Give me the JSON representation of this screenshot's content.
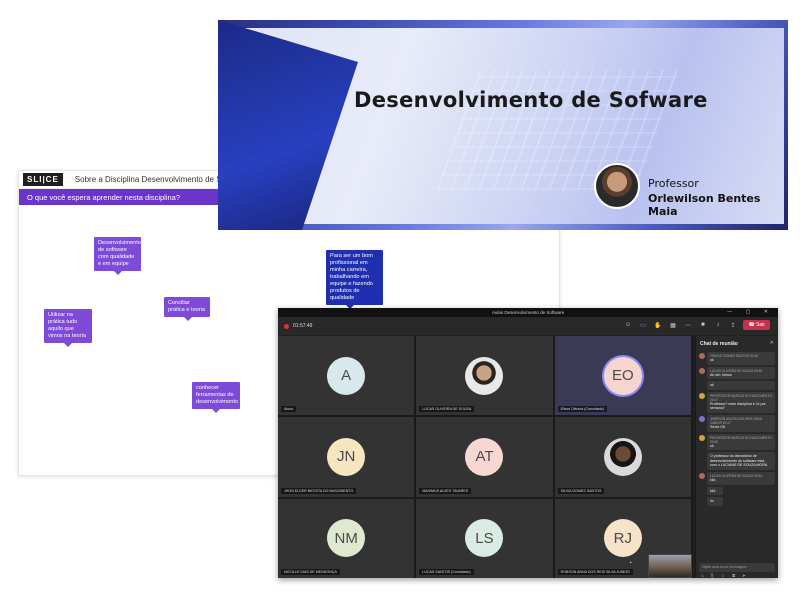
{
  "slido": {
    "logo": "SLI|CE",
    "title": "Sobre a Disciplina Desenvolvimento de Software",
    "question": "O que você espera aprender nesta disciplina?",
    "notes": [
      {
        "text": "Desenvolvimento de software com qualidade e em equipe",
        "color": "purple"
      },
      {
        "text": "Utilizar na prática tudo aquilo que vimos na teoria",
        "color": "purple"
      },
      {
        "text": "Conciliar prática e teoria",
        "color": "purple"
      },
      {
        "text": "conhecer ferramentas de desenvolvimento",
        "color": "purple"
      },
      {
        "text": "Para ser um bom profissional em minha carreira, trabalhando em equipe e fazendo produtos de qualidade",
        "color": "blue"
      }
    ]
  },
  "banner": {
    "title": "Desenvolvimento de Sofware",
    "professor_label": "Professor",
    "professor_name": "Orlewilson Bentes Maia"
  },
  "teams": {
    "window_title": "Aulas Desenvolvimento de Software",
    "window_controls": "— ▢ ✕",
    "timer": "01:57:49",
    "leave_label": "Sair",
    "participants": [
      {
        "initials": "A",
        "name": "Aluno",
        "avatar_color": "#d9e8ec",
        "photo": false,
        "speaking": false
      },
      {
        "initials": "",
        "name": "LUCAS OLIVEIRA DE SOUSA",
        "avatar_color": "",
        "photo": true,
        "speaking": false
      },
      {
        "initials": "EO",
        "name": "Eltron Oliveira (Convidado)",
        "avatar_color": "#f6d5cf",
        "photo": false,
        "speaking": true
      },
      {
        "initials": "JN",
        "name": "JHON ELDER BATISTA DO NASCIMENTO",
        "avatar_color": "#f6e6c0",
        "photo": false,
        "speaking": false
      },
      {
        "initials": "AT",
        "name": "MAXIMUS ALVES TAVARES",
        "avatar_color": "#f8d6d2",
        "photo": false,
        "speaking": false
      },
      {
        "initials": "",
        "name": "SILVIA GOMES SANTOS",
        "avatar_color": "",
        "photo": true,
        "speaking": false
      },
      {
        "initials": "NM",
        "name": "NICOLLE DIAS DE MENDONÇA",
        "avatar_color": "#dfe9cf",
        "photo": false,
        "speaking": false
      },
      {
        "initials": "LS",
        "name": "LUCAS SANTOS (Convidado)",
        "avatar_color": "#d9ebe2",
        "photo": false,
        "speaking": false
      },
      {
        "initials": "RJ",
        "name": "ROBSON ANNA DOS REIS SILVA JUNIOR",
        "avatar_color": "#f7e3c9",
        "photo": false,
        "speaking": false
      }
    ],
    "chat": {
      "header": "Chat de reunião",
      "close": "✕",
      "messages": [
        {
          "meta": "THIAGO GOMES SANTOS  20:45",
          "text": "ok"
        },
        {
          "meta": "LUCAS OLIVEIRA DE SOUZA  20:45",
          "text": "Ah dm, kimus"
        },
        {
          "meta": "",
          "text": "ok"
        },
        {
          "meta": "PROFESSOR MATEUS DO NASCIMENTO  20:47",
          "text": "Professor? esse disciplina é 2x por semana?"
        },
        {
          "meta": "JHERSON ANJOS DOS REIS SILVA JUNIOR  20:47",
          "text": "Sexta OK"
        },
        {
          "meta": "PROFESSOR MATEUS DO NASCIMENTO  20:49",
          "text": "ok"
        },
        {
          "meta": "",
          "text": "O professor do laboratório de desenvolvimento de software está com o LUCIANE DE SOUZA MORA"
        },
        {
          "meta": "LUCAS OLIVEIRA DE SOUZA  20:54",
          "text": "kkk"
        },
        {
          "meta": "",
          "text": "kkk"
        },
        {
          "meta": "",
          "text": "im"
        }
      ],
      "input_placeholder": "Digite uma nova mensagem",
      "input_tools": "A ⎘ ☺ ▦ ➤"
    }
  }
}
